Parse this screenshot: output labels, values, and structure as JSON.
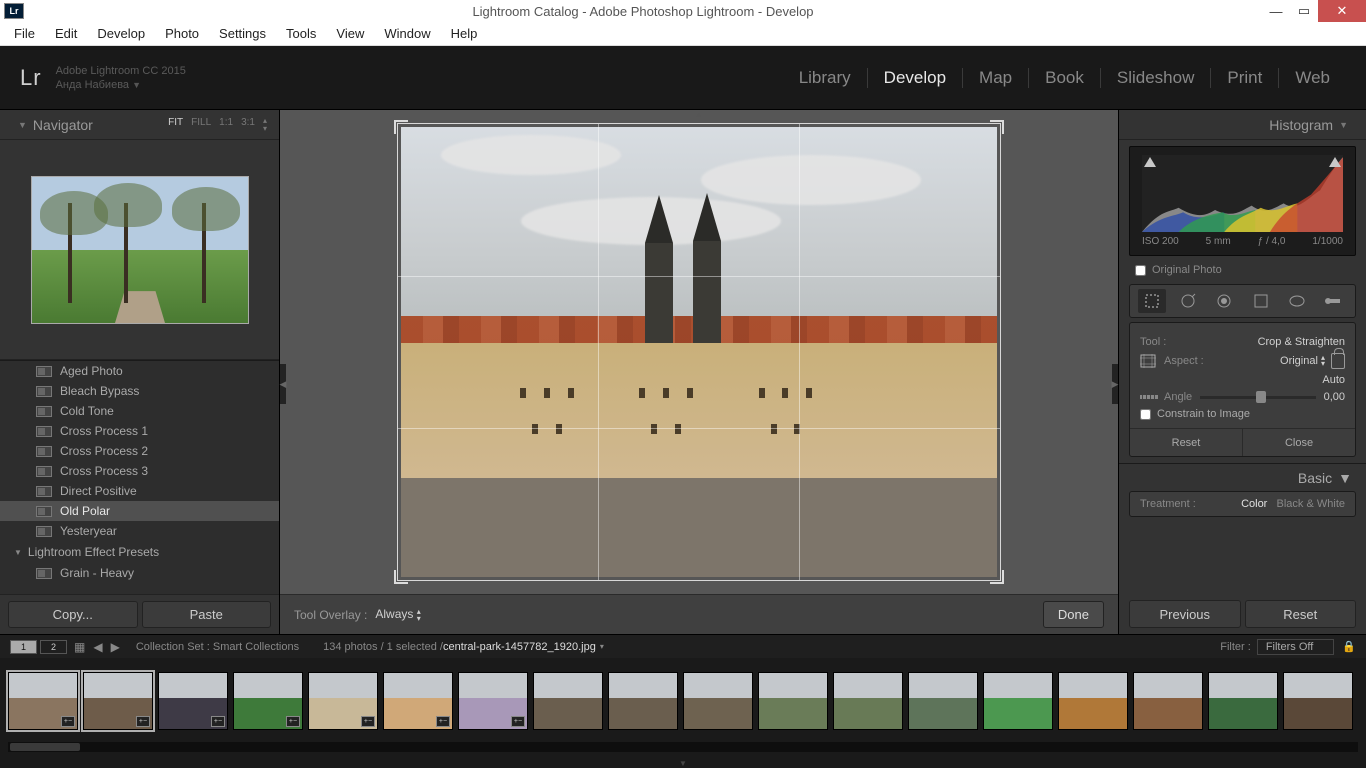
{
  "window": {
    "title": "Lightroom Catalog - Adobe Photoshop Lightroom - Develop",
    "app_badge": "Lr"
  },
  "menu": [
    "File",
    "Edit",
    "Develop",
    "Photo",
    "Settings",
    "Tools",
    "View",
    "Window",
    "Help"
  ],
  "identity": {
    "logo": "Lr",
    "line1": "Adobe Lightroom CC 2015",
    "line2": "Анда Набиева"
  },
  "modules": {
    "items": [
      "Library",
      "Develop",
      "Map",
      "Book",
      "Slideshow",
      "Print",
      "Web"
    ],
    "active": "Develop"
  },
  "navigator": {
    "title": "Navigator",
    "zoom": {
      "fit": "FIT",
      "fill": "FILL",
      "one": "1:1",
      "three": "3:1"
    }
  },
  "presets": {
    "items": [
      "Aged Photo",
      "Bleach Bypass",
      "Cold Tone",
      "Cross Process 1",
      "Cross Process 2",
      "Cross Process 3",
      "Direct Positive",
      "Old Polar",
      "Yesteryear"
    ],
    "selected": "Old Polar",
    "group": "Lightroom Effect Presets",
    "overflow_item": "Grain - Heavy"
  },
  "left_buttons": {
    "copy": "Copy...",
    "paste": "Paste"
  },
  "center": {
    "tool_overlay_label": "Tool Overlay :",
    "tool_overlay_value": "Always",
    "done": "Done"
  },
  "histogram": {
    "title": "Histogram",
    "iso": "ISO 200",
    "focal": "5 mm",
    "aperture": "ƒ / 4,0",
    "shutter": "1/1000",
    "original": "Original Photo"
  },
  "tool": {
    "label": "Tool :",
    "name": "Crop & Straighten",
    "aspect_label": "Aspect :",
    "aspect_value": "Original",
    "auto": "Auto",
    "angle_label": "Angle",
    "angle_value": "0,00",
    "constrain": "Constrain to Image",
    "reset": "Reset",
    "close": "Close"
  },
  "basic": {
    "title": "Basic",
    "treatment_label": "Treatment :",
    "color": "Color",
    "bw": "Black & White"
  },
  "right_buttons": {
    "previous": "Previous",
    "reset": "Reset"
  },
  "secondary": {
    "tabs": [
      "1",
      "2"
    ],
    "collection": "Collection Set : Smart Collections",
    "count": "134 photos / 1 selected /",
    "filename": "central-park-1457782_1920.jpg",
    "filter_label": "Filter :",
    "filter_value": "Filters Off"
  },
  "filmstrip": {
    "thumb_colors": [
      "#8a7560",
      "#6e5c4a",
      "#3e3a46",
      "#3e7a3a",
      "#c8b898",
      "#d0a878",
      "#a898b8",
      "#6a5e4e",
      "#6a5e4e",
      "#6e6250",
      "#6a7c58",
      "#687a56",
      "#5e745a",
      "#4c9850",
      "#b07838",
      "#886040",
      "#3a6a3e",
      "#5a4838"
    ]
  }
}
